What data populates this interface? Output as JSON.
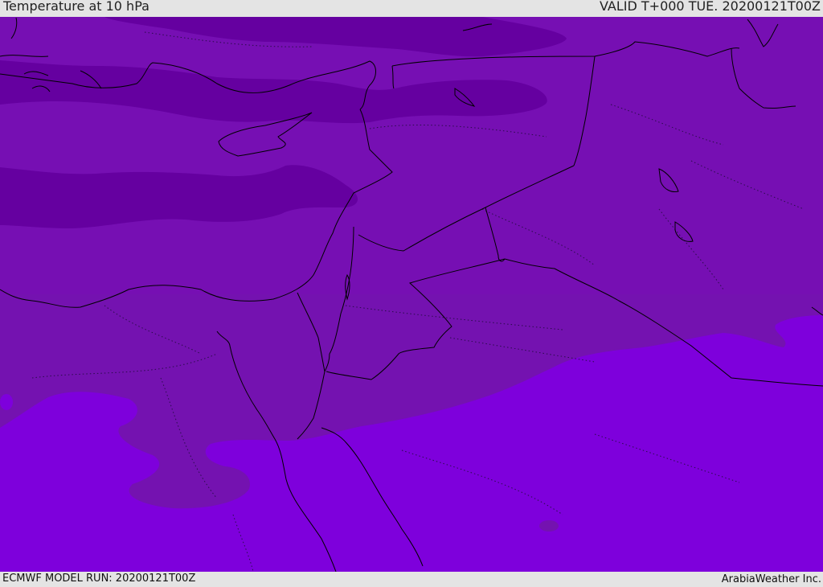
{
  "header": {
    "title": "Temperature at 10 hPa",
    "valid_time": "VALID T+000 TUE. 20200121T00Z"
  },
  "footer": {
    "model_run": "ECMWF MODEL RUN: 20200121T00Z",
    "credit": "ArabiaWeather Inc."
  },
  "map": {
    "variable": "temperature",
    "pressure_level": "10 hPa",
    "region": "Eastern Mediterranean / Middle East",
    "colors": {
      "cold_band": "#6500a0",
      "mid_band": "#760fb3",
      "mid_band_2": "#7412b0",
      "warm_zone": "#7e00dc",
      "coastline": "#000000"
    }
  }
}
